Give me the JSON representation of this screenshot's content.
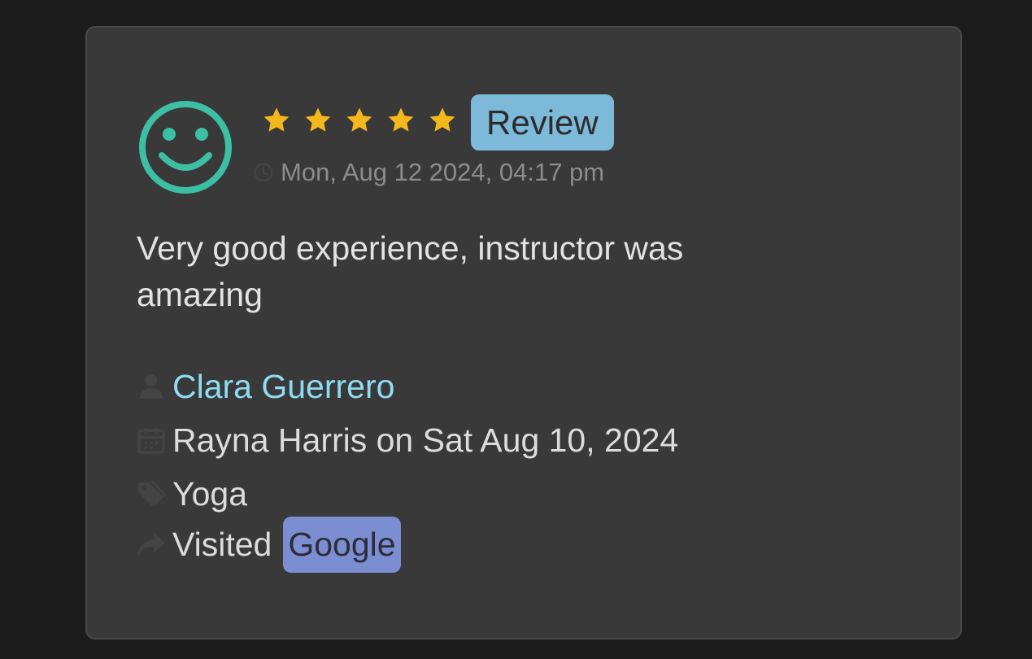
{
  "review": {
    "rating": 5,
    "max_rating": 5,
    "type_badge": "Review",
    "timestamp": "Mon, Aug 12 2024, 04:17 pm",
    "text": "Very good experience, instructor was amazing",
    "customer_name": "Clara Guerrero",
    "booking": "Rayna Harris on Sat Aug 10, 2024",
    "category": "Yoga",
    "visited_label": "Visited",
    "source": "Google"
  },
  "icons": {
    "avatar": "smiley-face-icon",
    "time": "clock-icon",
    "customer": "user-icon",
    "booking": "calendar-icon",
    "category": "tag-icon",
    "source": "share-arrow-icon"
  },
  "colors": {
    "background": "#1c1c1d",
    "card": "#393939",
    "avatar": "#3cbfa3",
    "star": "#f5b81c",
    "review_badge": "#7db9d8",
    "google_badge": "#7b8ed2",
    "link": "#8fdcf2"
  }
}
